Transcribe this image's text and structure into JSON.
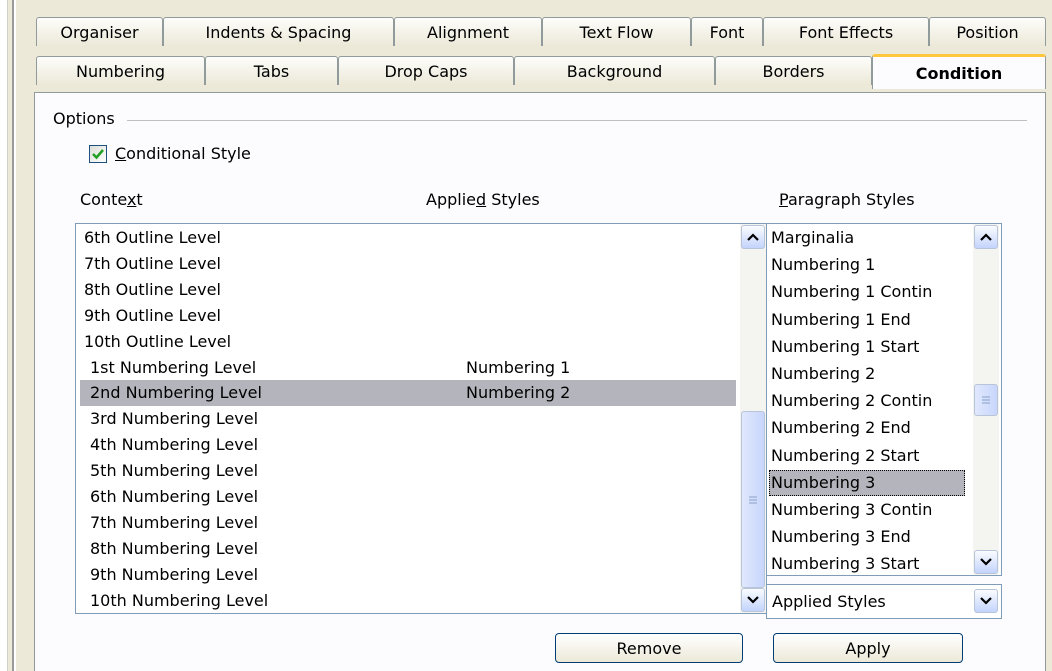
{
  "tabs_row1": [
    "Organiser",
    "Indents & Spacing",
    "Alignment",
    "Text Flow",
    "Font",
    "Font Effects",
    "Position"
  ],
  "tabs_row2": [
    "Numbering",
    "Tabs",
    "Drop Caps",
    "Background",
    "Borders",
    "Condition"
  ],
  "active_tab": "Condition",
  "options": {
    "group_label": "Options",
    "conditional_style_label": "Conditional Style",
    "conditional_style_accel": "C",
    "conditional_style_rest": "onditional Style",
    "conditional_style_checked": true
  },
  "context": {
    "label_pre": "Conte",
    "label_accel": "x",
    "label_post": "t",
    "applied_label_pre": "Applie",
    "applied_label_accel": "d",
    "applied_label_post": " Styles",
    "rows": [
      {
        "context": "6th Outline Level",
        "applied": ""
      },
      {
        "context": "7th Outline Level",
        "applied": ""
      },
      {
        "context": "8th Outline Level",
        "applied": ""
      },
      {
        "context": "9th Outline Level",
        "applied": ""
      },
      {
        "context": "10th Outline Level",
        "applied": ""
      },
      {
        "context": "1st Numbering Level",
        "applied": "Numbering 1"
      },
      {
        "context": "2nd Numbering Level",
        "applied": "Numbering 2"
      },
      {
        "context": "3rd Numbering Level",
        "applied": ""
      },
      {
        "context": "4th Numbering Level",
        "applied": ""
      },
      {
        "context": "5th Numbering Level",
        "applied": ""
      },
      {
        "context": "6th Numbering Level",
        "applied": ""
      },
      {
        "context": "7th Numbering Level",
        "applied": ""
      },
      {
        "context": "8th Numbering Level",
        "applied": ""
      },
      {
        "context": "9th Numbering Level",
        "applied": ""
      },
      {
        "context": "10th Numbering Level",
        "applied": ""
      }
    ],
    "selected_index": 6
  },
  "paragraph_styles": {
    "label_accel": "P",
    "label_rest": "aragraph Styles",
    "items": [
      "Marginalia",
      "Numbering 1",
      "Numbering 1 Contin",
      "Numbering 1 End",
      "Numbering 1 Start",
      "Numbering 2",
      "Numbering 2 Contin",
      "Numbering 2 End",
      "Numbering 2 Start",
      "Numbering 3",
      "Numbering 3 Contin",
      "Numbering 3 End",
      "Numbering 3 Start"
    ],
    "selected_index": 9,
    "filter_value": "Applied Styles"
  },
  "buttons": {
    "remove": "Remove",
    "apply": "Apply"
  },
  "icons": {
    "scroll_up": "chevron-up-icon",
    "scroll_down": "chevron-down-icon",
    "thumb_grip": "grip-icon",
    "check": "checkmark-icon"
  },
  "colors": {
    "dialog_bg": "#ece9d8",
    "panel_bg": "#fcfcfe",
    "selection": "#b4b4bc",
    "active_tab_accent": "#ffc83c",
    "check_green": "#21a121"
  }
}
